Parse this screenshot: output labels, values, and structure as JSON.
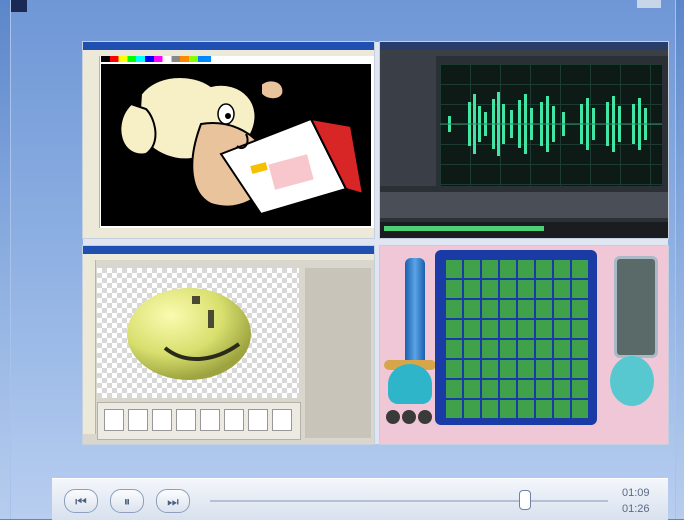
{
  "window": {
    "title": ""
  },
  "panels": {
    "paint": {
      "name": "paint-app"
    },
    "audio": {
      "name": "audio-editor"
    },
    "photoshop": {
      "name": "image-editor"
    },
    "game": {
      "name": "puzzle-game"
    }
  },
  "player": {
    "prev_icon": "⏮",
    "pause_icon": "⏸",
    "next_icon": "⏭",
    "current_time": "01:09",
    "total_time": "01:26",
    "progress": 0.79
  },
  "colors": {
    "accent": "#6f97d6",
    "waveform": "#42e6a4",
    "board": "#1a3aa6",
    "tile": "#3fa24b"
  }
}
